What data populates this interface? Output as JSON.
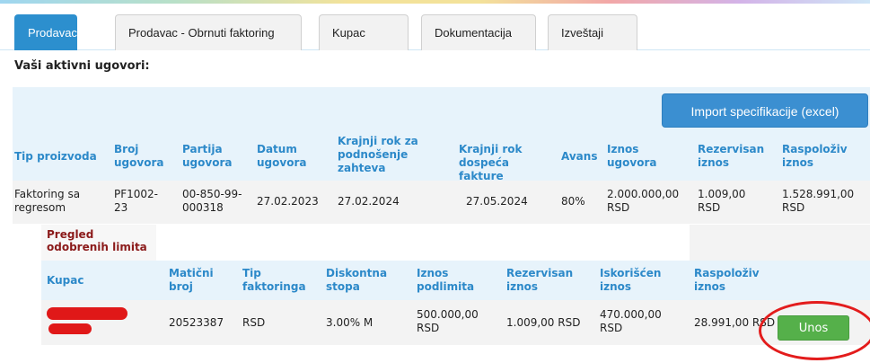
{
  "tabs": [
    {
      "label": "Prodavac",
      "active": true
    },
    {
      "label": "Prodavac - Obrnuti faktoring",
      "active": false
    },
    {
      "label": "Kupac",
      "active": false
    },
    {
      "label": "Dokumentacija",
      "active": false
    },
    {
      "label": "Izveštaji",
      "active": false
    }
  ],
  "heading": "Vaši aktivni ugovori:",
  "import_button": "Import specifikacije (excel)",
  "contracts": {
    "headers": {
      "tip": "Tip proizvoda",
      "broj": "Broj ugovora",
      "partija": "Partija ugovora",
      "datum": "Datum ugovora",
      "rok_podnosenje": "Krajnji rok za podnošenje zahteva",
      "rok_dospeca": "Krajnji rok dospeća fakture",
      "avans": "Avans",
      "iznos": "Iznos ugovora",
      "rezervisan": "Rezervisan iznos",
      "raspoloziv": "Raspoloživ iznos"
    },
    "row": {
      "tip": "Faktoring sa regresom",
      "broj": "PF1002-23",
      "partija": "00-850-99-000318",
      "datum": "27.02.2023",
      "rok_podnosenje": "27.02.2024",
      "rok_dospeca": "27.05.2024",
      "avans": "80%",
      "iznos": "2.000.000,00 RSD",
      "rezervisan": "1.009,00 RSD",
      "raspoloziv": "1.528.991,00 RSD"
    }
  },
  "limits": {
    "title": "Pregled odobrenih limita",
    "headers": {
      "kupac": "Kupac",
      "maticni": "Matični broj",
      "tip_faktoringa": "Tip faktoringa",
      "diskontna": "Diskontna stopa",
      "iznos_podlimita": "Iznos podlimita",
      "rezervisan": "Rezervisan iznos",
      "iskoriscen": "Iskorišćen iznos",
      "raspoloziv": "Raspoloživ iznos"
    },
    "row": {
      "maticni": "20523387",
      "tip_faktoringa": "RSD",
      "diskontna": "3.00% M",
      "iznos_podlimita": "500.000,00 RSD",
      "rezervisan": "1.009,00 RSD",
      "iskoriscen": "470.000,00 RSD",
      "raspoloziv": "28.991,00 RSD"
    },
    "action_button": "Unos"
  },
  "colors": {
    "accent": "#2c8fce",
    "header_text": "#2c89c9",
    "limits_title": "#8b1a1a",
    "action_green": "#55b04a",
    "annotation_red": "#e31c1c"
  }
}
